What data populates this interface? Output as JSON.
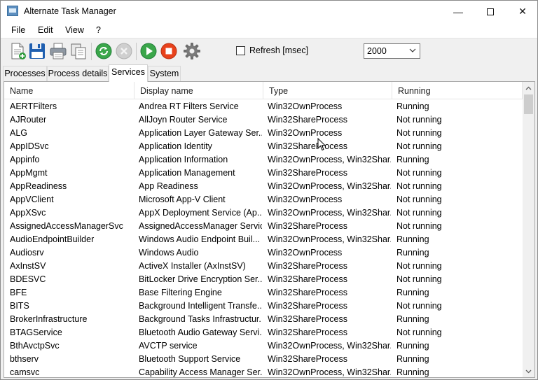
{
  "window": {
    "title": "Alternate Task Manager",
    "minimize_glyph": "—",
    "close_glyph": "✕"
  },
  "menu": [
    "File",
    "Edit",
    "View",
    "?"
  ],
  "toolbar": {
    "icons": [
      "new-document-icon",
      "save-icon",
      "print-icon",
      "copy-icon",
      "refresh-icon",
      "stop-gray-icon",
      "play-icon",
      "stop-red-icon",
      "gear-icon"
    ],
    "refresh_label": "Refresh [msec]",
    "refresh_checked": false,
    "refresh_interval": "2000"
  },
  "tabs": [
    {
      "label": "Processes",
      "active": false
    },
    {
      "label": "Process details",
      "active": false
    },
    {
      "label": "Services",
      "active": true
    },
    {
      "label": "System",
      "active": false
    }
  ],
  "table": {
    "columns": [
      "Name",
      "Display name",
      "Type",
      "Running"
    ],
    "rows": [
      [
        "AERTFilters",
        "Andrea RT Filters Service",
        "Win32OwnProcess",
        "Running"
      ],
      [
        "AJRouter",
        "AllJoyn Router Service",
        "Win32ShareProcess",
        "Not running"
      ],
      [
        "ALG",
        "Application Layer Gateway Ser...",
        "Win32OwnProcess",
        "Not running"
      ],
      [
        "AppIDSvc",
        "Application Identity",
        "Win32ShareProcess",
        "Not running"
      ],
      [
        "Appinfo",
        "Application Information",
        "Win32OwnProcess, Win32Shar...",
        "Running"
      ],
      [
        "AppMgmt",
        "Application Management",
        "Win32ShareProcess",
        "Not running"
      ],
      [
        "AppReadiness",
        "App Readiness",
        "Win32OwnProcess, Win32Shar...",
        "Not running"
      ],
      [
        "AppVClient",
        "Microsoft App-V Client",
        "Win32OwnProcess",
        "Not running"
      ],
      [
        "AppXSvc",
        "AppX Deployment Service (Ap...",
        "Win32OwnProcess, Win32Shar...",
        "Not running"
      ],
      [
        "AssignedAccessManagerSvc",
        "AssignedAccessManager Service",
        "Win32ShareProcess",
        "Not running"
      ],
      [
        "AudioEndpointBuilder",
        "Windows Audio Endpoint Buil...",
        "Win32OwnProcess, Win32Shar...",
        "Running"
      ],
      [
        "Audiosrv",
        "Windows Audio",
        "Win32OwnProcess",
        "Running"
      ],
      [
        "AxInstSV",
        "ActiveX Installer (AxInstSV)",
        "Win32ShareProcess",
        "Not running"
      ],
      [
        "BDESVC",
        "BitLocker Drive Encryption Ser...",
        "Win32ShareProcess",
        "Not running"
      ],
      [
        "BFE",
        "Base Filtering Engine",
        "Win32ShareProcess",
        "Running"
      ],
      [
        "BITS",
        "Background Intelligent Transfe...",
        "Win32ShareProcess",
        "Not running"
      ],
      [
        "BrokerInfrastructure",
        "Background Tasks Infrastructur...",
        "Win32ShareProcess",
        "Running"
      ],
      [
        "BTAGService",
        "Bluetooth Audio Gateway Servi...",
        "Win32ShareProcess",
        "Not running"
      ],
      [
        "BthAvctpSvc",
        "AVCTP service",
        "Win32OwnProcess, Win32Shar...",
        "Running"
      ],
      [
        "bthserv",
        "Bluetooth Support Service",
        "Win32ShareProcess",
        "Running"
      ],
      [
        "camsvc",
        "Capability Access Manager Ser...",
        "Win32OwnProcess, Win32Shar...",
        "Running"
      ]
    ]
  }
}
